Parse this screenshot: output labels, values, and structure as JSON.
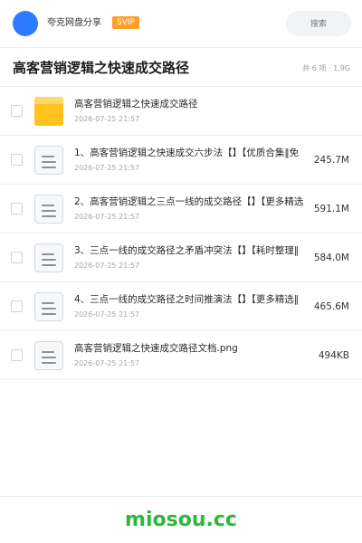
{
  "header": {
    "share_name": "夸克网盘分享",
    "badge": "SVIP",
    "search_placeholder": "搜索"
  },
  "folder": {
    "title": "高客营销逻辑之快速成交路径",
    "meta": "共 6 项 · 1.9G"
  },
  "files": [
    {
      "type": "folder",
      "name": "高客营销逻辑之快速成交路径",
      "date": "2026-07-25 21:57",
      "size": ""
    },
    {
      "type": "document",
      "name": "1、高客营销逻辑之快速成交六步法【】【优质合集‖免",
      "date": "2026-07-25 21:57",
      "size": "245.7M"
    },
    {
      "type": "document",
      "name": "2、高客营销逻辑之三点一线的成交路径【】【更多精选",
      "date": "2026-07-25 21:57",
      "size": "591.1M"
    },
    {
      "type": "document",
      "name": "3、三点一线的成交路径之矛盾冲突法【】【耗时整理‖",
      "date": "2026-07-25 21:57",
      "size": "584.0M"
    },
    {
      "type": "document",
      "name": "4、三点一线的成交路径之时间推演法【】【更多精选‖",
      "date": "2026-07-25 21:57",
      "size": "465.6M"
    },
    {
      "type": "document",
      "name": "高客营销逻辑之快速成交路径文档.png",
      "date": "2026-07-25 21:57",
      "size": "494KB"
    }
  ],
  "footer": {
    "watermark": "miosou.cc"
  },
  "colors": {
    "avatar": "#2f7bff",
    "badge": "#ff9e2b",
    "folder_icon": "#ffc21f",
    "watermark": "#2eb73c"
  }
}
